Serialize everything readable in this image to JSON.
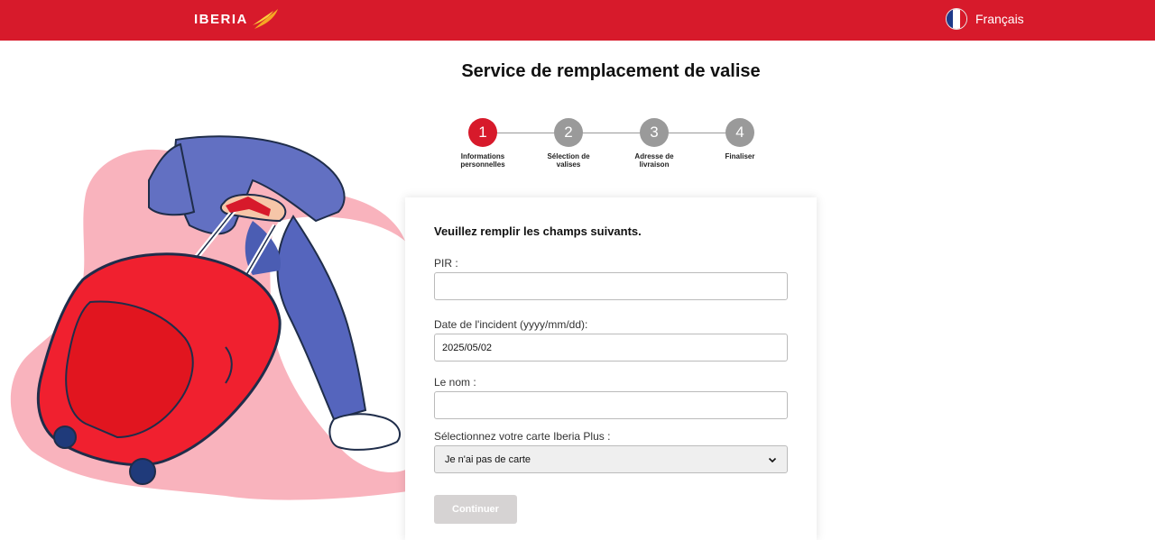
{
  "header": {
    "logo_text": "IBERIA",
    "language_label": "Français"
  },
  "page": {
    "title": "Service de remplacement de valise"
  },
  "stepper": {
    "current": 1,
    "steps": [
      {
        "number": "1",
        "label": "Informations personnelles",
        "active": true
      },
      {
        "number": "2",
        "label": "Sélection de valises",
        "active": false
      },
      {
        "number": "3",
        "label": "Adresse de livraison",
        "active": false
      },
      {
        "number": "4",
        "label": "Finaliser",
        "active": false
      }
    ]
  },
  "form": {
    "heading": "Veuillez remplir les champs suivants.",
    "pir": {
      "label": "PIR :",
      "value": ""
    },
    "incident_date": {
      "label": "Date de l'incident (yyyy/mm/dd):",
      "value": "2025/05/02"
    },
    "name": {
      "label": "Le nom :",
      "value": ""
    },
    "iberia_plus": {
      "label": "Sélectionnez votre carte Iberia Plus :",
      "selected": "Je n'ai pas de carte"
    },
    "submit_label": "Continuer"
  },
  "colors": {
    "brand_red": "#d71a2b",
    "step_inactive": "#9a9a9a",
    "button_disabled": "#d6d3d3",
    "illustration_pink": "#f7a8b3",
    "suitcase_red": "#f0202f",
    "jeans_blue": "#5f6fbd"
  },
  "icons": {
    "logo": "iberia-logo-icon",
    "flag": "french-flag-icon",
    "select": "chevron-down-icon",
    "illustration": "traveler-suitcase-illustration"
  }
}
